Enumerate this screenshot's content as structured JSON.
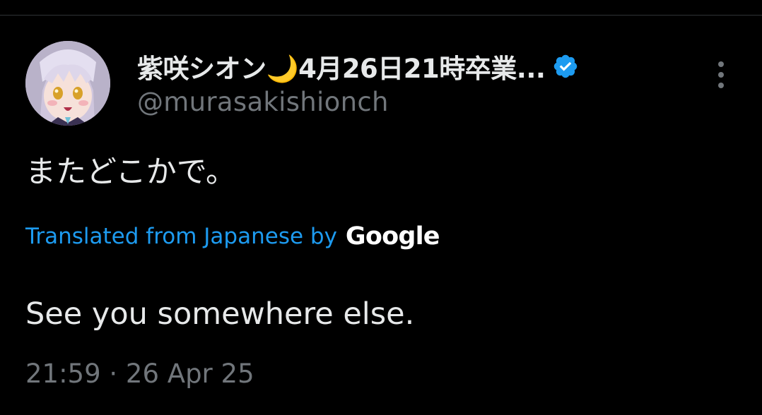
{
  "tweet": {
    "author": {
      "display_name": "紫咲シオン🌙4月26日21時卒業...",
      "handle": "@murasakishionch",
      "verified": true,
      "avatar_icon": "avatar-image",
      "verified_icon": "verified-badge-icon"
    },
    "more_icon": "more-options-icon",
    "text": "またどこかで。",
    "translation": {
      "label": "Translated from Japanese by",
      "provider": "Google",
      "text": "See you somewhere else."
    },
    "timestamp": "21:59 · 26 Apr 25"
  },
  "colors": {
    "background": "#000000",
    "primary_text": "#e7e9ea",
    "secondary_text": "#71767b",
    "link": "#1d9bf0",
    "verified": "#1d9bf0",
    "divider": "#2f3336"
  }
}
